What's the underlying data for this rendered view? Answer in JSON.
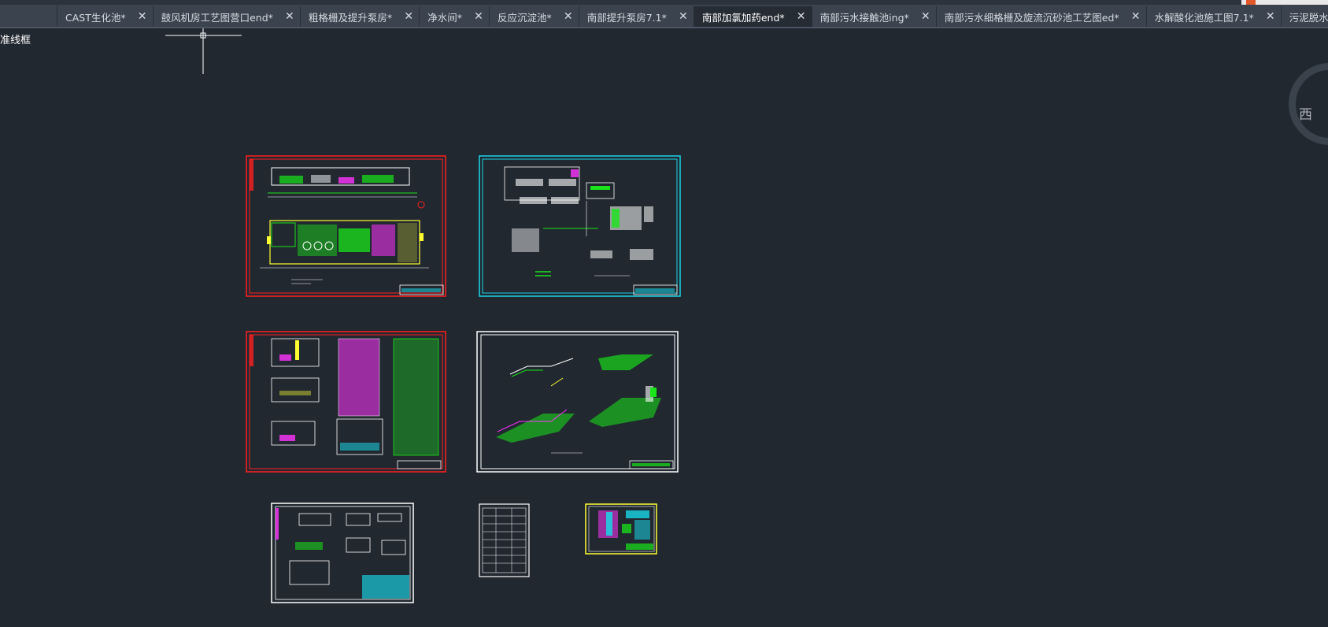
{
  "tabs": [
    {
      "label": "CAST生化池*",
      "active": false
    },
    {
      "label": "鼓风机房工艺图营口end*",
      "active": false
    },
    {
      "label": "粗格栅及提升泵房*",
      "active": false
    },
    {
      "label": "净水间*",
      "active": false
    },
    {
      "label": "反应沉淀池*",
      "active": false
    },
    {
      "label": "南部提升泵房7.1*",
      "active": false
    },
    {
      "label": "南部加氯加药end*",
      "active": true
    },
    {
      "label": "南部污水接触池ing*",
      "active": false
    },
    {
      "label": "南部污水细格栅及旋流沉砂池工艺图ed*",
      "active": false
    },
    {
      "label": "水解酸化池施工图7.1*",
      "active": false
    },
    {
      "label": "污泥脱水间*",
      "active": false
    }
  ],
  "tab_close_glyph": "✕",
  "view_label": "准线框",
  "viewcube": {
    "label": "西"
  },
  "colors": {
    "background": "#212830",
    "tab_bar": "#3b434e",
    "tab_active": "#262c34",
    "crosshair": "#ffffff",
    "sheet_red": "#ff1f1f",
    "sheet_cyan": "#19d6e6",
    "sheet_white": "#ffffff",
    "linework_green": "#19e619",
    "linework_magenta": "#ff33ff",
    "linework_yellow": "#ffff33"
  },
  "icons": {
    "crosshair": "crosshair-cursor-icon",
    "tab_close": "close-icon",
    "viewcube": "viewcube-icon"
  }
}
